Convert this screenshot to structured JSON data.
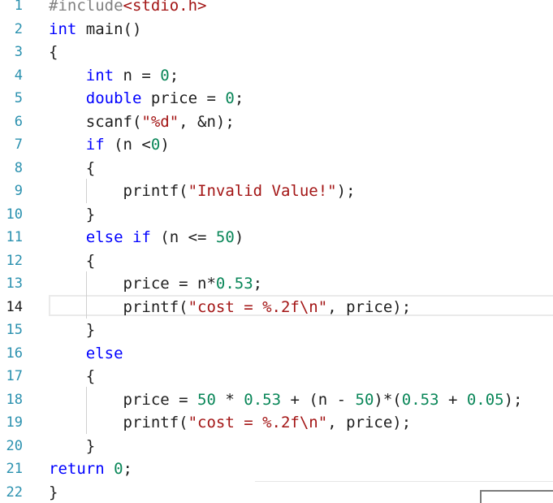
{
  "editor": {
    "current_line": 14,
    "lines": [
      {
        "num": "1",
        "tokens": [
          [
            "pp",
            "#include"
          ],
          [
            "inc",
            "<stdio.h>"
          ]
        ]
      },
      {
        "num": "2",
        "tokens": [
          [
            "kw",
            "int"
          ],
          [
            "fn",
            " main()"
          ]
        ]
      },
      {
        "num": "3",
        "tokens": [
          [
            "fn",
            "{"
          ]
        ]
      },
      {
        "num": "4",
        "tokens": [
          [
            "fn",
            "    "
          ],
          [
            "kw",
            "int"
          ],
          [
            "fn",
            " n = "
          ],
          [
            "num",
            "0"
          ],
          [
            "fn",
            ";"
          ]
        ]
      },
      {
        "num": "5",
        "tokens": [
          [
            "fn",
            "    "
          ],
          [
            "kw",
            "double"
          ],
          [
            "fn",
            " price = "
          ],
          [
            "num",
            "0"
          ],
          [
            "fn",
            ";"
          ]
        ]
      },
      {
        "num": "6",
        "tokens": [
          [
            "fn",
            "    scanf("
          ],
          [
            "str",
            "\"%d\""
          ],
          [
            "fn",
            ", &n);"
          ]
        ]
      },
      {
        "num": "7",
        "tokens": [
          [
            "fn",
            "    "
          ],
          [
            "kw",
            "if"
          ],
          [
            "fn",
            " (n <"
          ],
          [
            "num",
            "0"
          ],
          [
            "fn",
            ")"
          ]
        ]
      },
      {
        "num": "8",
        "tokens": [
          [
            "fn",
            "    {"
          ]
        ]
      },
      {
        "num": "9",
        "tokens": [
          [
            "fn",
            "        printf("
          ],
          [
            "str",
            "\"Invalid Value!\""
          ],
          [
            "fn",
            ");"
          ]
        ]
      },
      {
        "num": "10",
        "tokens": [
          [
            "fn",
            "    }"
          ]
        ]
      },
      {
        "num": "11",
        "tokens": [
          [
            "fn",
            "    "
          ],
          [
            "kw",
            "else if"
          ],
          [
            "fn",
            " (n <= "
          ],
          [
            "num",
            "50"
          ],
          [
            "fn",
            ")"
          ]
        ]
      },
      {
        "num": "12",
        "tokens": [
          [
            "fn",
            "    {"
          ]
        ]
      },
      {
        "num": "13",
        "tokens": [
          [
            "fn",
            "        price = n*"
          ],
          [
            "num",
            "0.53"
          ],
          [
            "fn",
            ";"
          ]
        ]
      },
      {
        "num": "14",
        "tokens": [
          [
            "fn",
            "        printf("
          ],
          [
            "str",
            "\"cost = %.2f\\n\""
          ],
          [
            "fn",
            ", price);"
          ]
        ]
      },
      {
        "num": "15",
        "tokens": [
          [
            "fn",
            "    }"
          ]
        ]
      },
      {
        "num": "16",
        "tokens": [
          [
            "fn",
            "    "
          ],
          [
            "kw",
            "else"
          ]
        ]
      },
      {
        "num": "17",
        "tokens": [
          [
            "fn",
            "    {"
          ]
        ]
      },
      {
        "num": "18",
        "tokens": [
          [
            "fn",
            "        price = "
          ],
          [
            "num",
            "50"
          ],
          [
            "fn",
            " * "
          ],
          [
            "num",
            "0.53"
          ],
          [
            "fn",
            " + (n - "
          ],
          [
            "num",
            "50"
          ],
          [
            "fn",
            ")*("
          ],
          [
            "num",
            "0.53"
          ],
          [
            "fn",
            " + "
          ],
          [
            "num",
            "0.05"
          ],
          [
            "fn",
            ");"
          ]
        ]
      },
      {
        "num": "19",
        "tokens": [
          [
            "fn",
            "        printf("
          ],
          [
            "str",
            "\"cost = %.2f\\n\""
          ],
          [
            "fn",
            ", price);"
          ]
        ]
      },
      {
        "num": "20",
        "tokens": [
          [
            "fn",
            "    }"
          ]
        ]
      },
      {
        "num": "21",
        "tokens": [
          [
            "kw",
            "return"
          ],
          [
            "fn",
            " "
          ],
          [
            "num",
            "0"
          ],
          [
            "fn",
            ";"
          ]
        ]
      },
      {
        "num": "22",
        "tokens": [
          [
            "fn",
            "}"
          ]
        ]
      }
    ]
  },
  "colors": {
    "keyword": "#0000ff",
    "string": "#a31515",
    "number": "#098658",
    "preprocessor": "#808080",
    "line_number": "#2b91af"
  }
}
